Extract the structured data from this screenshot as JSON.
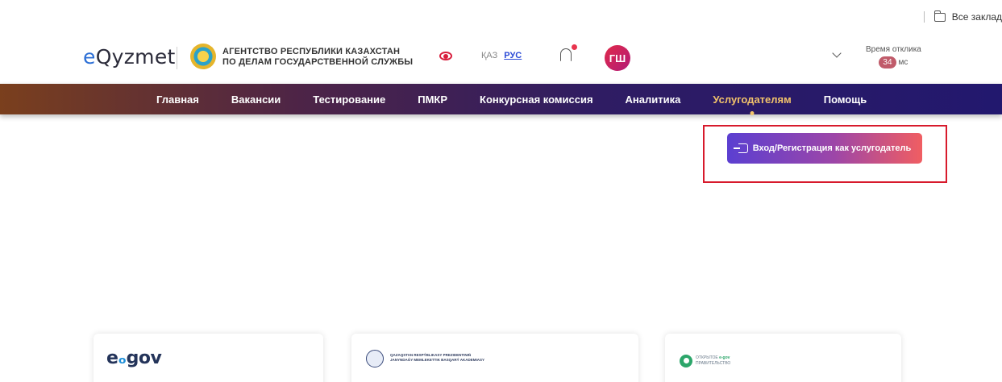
{
  "browser": {
    "bookmarks_label": "Все заклад"
  },
  "header": {
    "logo_prefix": "e",
    "logo_rest": "Qyzmet",
    "agency_line1": "АГЕНТСТВО РЕСПУБЛИКИ КАЗАХСТАН",
    "agency_line2": "ПО ДЕЛАМ ГОСУДАРСТВЕННОЙ СЛУЖБЫ",
    "lang_kaz": "ҚАЗ",
    "lang_rus": "РУС",
    "avatar_initials": "ГШ",
    "response_label": "Время отклика",
    "response_value": "34",
    "response_unit": "мс"
  },
  "nav": {
    "items": [
      {
        "label": "Главная"
      },
      {
        "label": "Вакансии"
      },
      {
        "label": "Тестирование"
      },
      {
        "label": "ПМКР"
      },
      {
        "label": "Конкурсная комиссия"
      },
      {
        "label": "Аналитика"
      },
      {
        "label": "Услугодателям"
      },
      {
        "label": "Помощь"
      }
    ],
    "active_index": 6
  },
  "main": {
    "login_button_label": "Вход/Регистрация как услугодатель"
  },
  "partners": {
    "egov_prefix": "e",
    "egov_dot": "ₒ",
    "egov_rest": "gov",
    "academy_line1": "QAZAQSTAN RESPÝBLIKASY PREZIDENTINIŃ",
    "academy_line2": "JANYNDAǴY MEMLEKETTIK BASQARÝ AKADEMIASY",
    "opengov_line1_a": "ОТКРЫТОЕ ",
    "opengov_line1_b": "e-gov",
    "opengov_line2": "ПРАВИТЕЛЬСТВО"
  },
  "colors": {
    "accent_blue": "#2c6fd6",
    "nav_active": "#f3c46b",
    "highlight_red": "#d71a2c"
  }
}
